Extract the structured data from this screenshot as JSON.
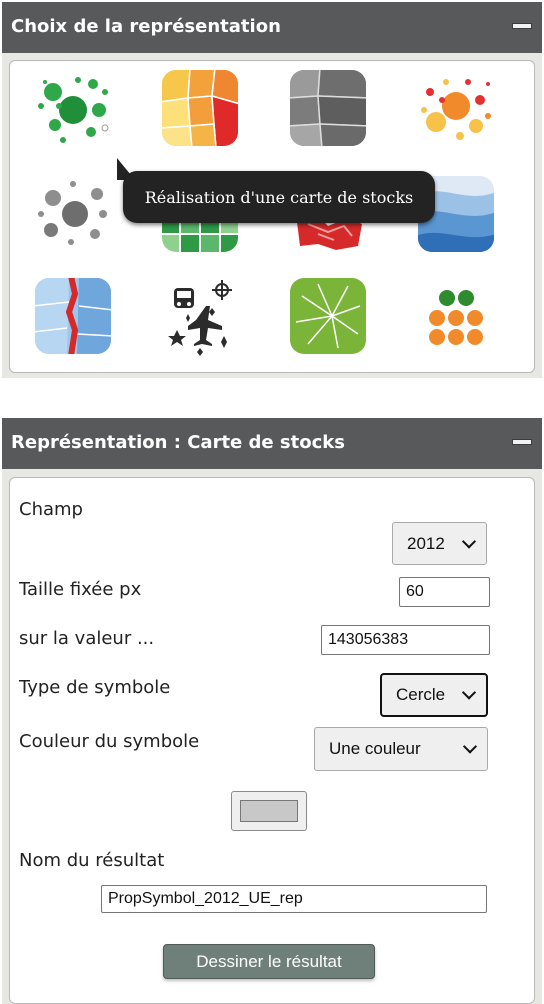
{
  "panel1": {
    "title": "Choix de la représentation",
    "icons": [
      "proportional-symbols-green-icon",
      "choropleth-warm-icon",
      "choropleth-gray-icon",
      "proportional-symbols-warm-icon",
      "proportional-symbols-gray-icon",
      "grid-green-icon",
      "red-patch-map-icon",
      "isopleth-blue-icon",
      "discontinuity-map-icon",
      "typo-symbols-icon",
      "flows-green-icon",
      "waffle-dots-icon"
    ],
    "tooltip": "Réalisation d'une carte de stocks"
  },
  "panel2": {
    "title": "Représentation : Carte de stocks",
    "champ_label": "Champ",
    "champ_value": "2012",
    "taille_label": "Taille fixée px",
    "taille_value": "60",
    "valeur_label": "sur la valeur ...",
    "valeur_value": "143056383",
    "type_label": "Type de symbole",
    "type_value": "Cercle",
    "couleur_label": "Couleur du symbole",
    "couleur_value": "Une couleur",
    "swatch_color": "#c8c8c8",
    "nom_label": "Nom du résultat",
    "nom_value": "PropSymbol_2012_UE_rep",
    "draw_label": "Dessiner le résultat"
  }
}
